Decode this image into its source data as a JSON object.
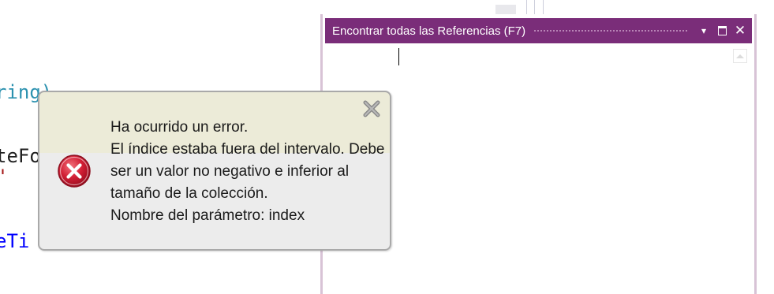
{
  "editor": {
    "lines": [
      {
        "text": "ring)",
        "color": "#2b91af"
      },
      {
        "text": "teFo",
        "color": "#1e1e1e"
      },
      {
        "text": "\"",
        "color": "#a31515"
      },
      {
        "text": "eTi",
        "color": "#0000ff"
      }
    ]
  },
  "find_references": {
    "title": "Encontrar todas las Referencias (F7)",
    "dropdown_glyph": "▾",
    "close_glyph": "✕"
  },
  "error_popup": {
    "lines": [
      "Ha ocurrido un error.",
      "El índice estaba fuera del intervalo. Debe",
      "ser un valor no negativo e inferior al",
      "tamaño de la colección.",
      "Nombre del parámetro: index"
    ],
    "icon": "error-icon",
    "close_icon": "close-icon"
  },
  "colors": {
    "tool_window_accent": "#7a2d79",
    "popup_top_band": "#ecebd8",
    "popup_body": "#ececec",
    "error_red": "#c8102e"
  }
}
